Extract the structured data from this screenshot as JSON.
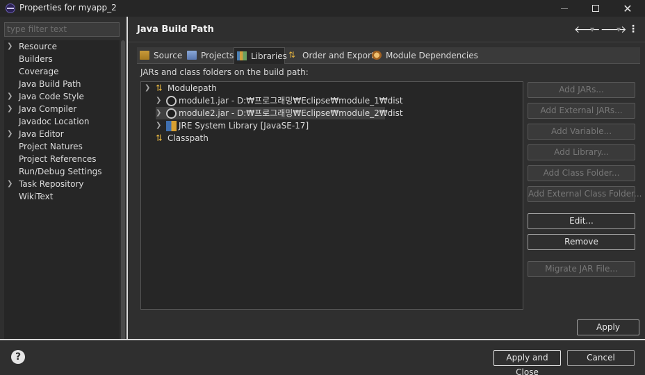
{
  "window": {
    "title": "Properties for myapp_2",
    "icon": "eclipse-icon",
    "controls": [
      "minimize-icon",
      "maximize-icon",
      "close-icon"
    ]
  },
  "sidebar": {
    "filter_placeholder": "type filter text",
    "items": [
      {
        "label": "Resource",
        "expandable": true
      },
      {
        "label": "Builders",
        "expandable": false
      },
      {
        "label": "Coverage",
        "expandable": false
      },
      {
        "label": "Java Build Path",
        "expandable": false
      },
      {
        "label": "Java Code Style",
        "expandable": true
      },
      {
        "label": "Java Compiler",
        "expandable": true
      },
      {
        "label": "Javadoc Location",
        "expandable": false
      },
      {
        "label": "Java Editor",
        "expandable": true
      },
      {
        "label": "Project Natures",
        "expandable": false
      },
      {
        "label": "Project References",
        "expandable": false
      },
      {
        "label": "Run/Debug Settings",
        "expandable": false
      },
      {
        "label": "Task Repository",
        "expandable": true
      },
      {
        "label": "WikiText",
        "expandable": false
      }
    ]
  },
  "page": {
    "title": "Java Build Path",
    "nav_icons": [
      "back-arrow-icon",
      "forward-arrow-icon",
      "more-menu-icon"
    ],
    "tabs": [
      {
        "label": "Source",
        "icon": "source-folder-icon"
      },
      {
        "label": "Projects",
        "icon": "projects-folder-icon"
      },
      {
        "label": "Libraries",
        "icon": "libraries-icon",
        "active": true
      },
      {
        "label": "Order and Export",
        "icon": "order-export-icon"
      },
      {
        "label": "Module Dependencies",
        "icon": "module-dependencies-icon"
      }
    ],
    "caption": "JARs and class folders on the build path:",
    "tree": [
      {
        "label": "Modulepath",
        "level": 0,
        "expanded": true,
        "icon": "modulepath-icon"
      },
      {
        "label": "module1.jar - D:₩프로그래밍₩Eclipse₩module_1₩dist",
        "level": 1,
        "expanded": false,
        "icon": "jar-icon"
      },
      {
        "label": "module2.jar - D:₩프로그래밍₩Eclipse₩module_2₩dist",
        "level": 1,
        "expanded": false,
        "icon": "jar-icon",
        "selected": true
      },
      {
        "label": "JRE System Library [JavaSE-17]",
        "level": 1,
        "expanded": false,
        "icon": "jre-library-icon"
      },
      {
        "label": "Classpath",
        "level": 0,
        "expanded": null,
        "icon": "classpath-icon"
      }
    ],
    "buttons": [
      {
        "label": "Add JARs...",
        "enabled": false
      },
      {
        "label": "Add External JARs...",
        "enabled": false
      },
      {
        "label": "Add Variable...",
        "enabled": false
      },
      {
        "label": "Add Library...",
        "enabled": false
      },
      {
        "label": "Add Class Folder...",
        "enabled": false
      },
      {
        "label": "Add External Class Folder...",
        "enabled": false
      },
      {
        "label": "Edit...",
        "enabled": true
      },
      {
        "label": "Remove",
        "enabled": true
      },
      {
        "label": "Migrate JAR File...",
        "enabled": false
      }
    ],
    "apply_label": "Apply"
  },
  "footer": {
    "help_icon": "help-icon",
    "help_glyph": "?",
    "apply_close_label": "Apply and Close",
    "cancel_label": "Cancel"
  }
}
